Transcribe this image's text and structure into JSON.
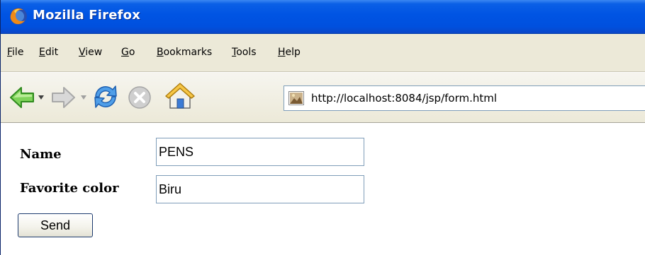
{
  "window": {
    "title": "Mozilla Firefox"
  },
  "menu": {
    "items": [
      {
        "accel": "F",
        "rest": "ile"
      },
      {
        "accel": "E",
        "rest": "dit"
      },
      {
        "accel": "V",
        "rest": "iew"
      },
      {
        "accel": "G",
        "rest": "o"
      },
      {
        "accel": "B",
        "rest": "ookmarks"
      },
      {
        "accel": "T",
        "rest": "ools"
      },
      {
        "accel": "H",
        "rest": "elp"
      }
    ]
  },
  "toolbar": {
    "icons": [
      "back-arrow-icon",
      "dropdown-arrow-icon",
      "forward-arrow-icon",
      "dropdown-arrow-icon",
      "reload-icon",
      "stop-icon",
      "home-icon"
    ],
    "address": {
      "value": "http://localhost:8084/jsp/form.html",
      "favicon": "page-icon"
    }
  },
  "form": {
    "name_label": "Name",
    "name_value": "PENS",
    "color_label": "Favorite color",
    "color_value": "Biru",
    "submit_label": "Send"
  },
  "colors": {
    "titlebar": "#0054e3",
    "chrome": "#ece9d8",
    "input_border": "#7f9db9"
  }
}
